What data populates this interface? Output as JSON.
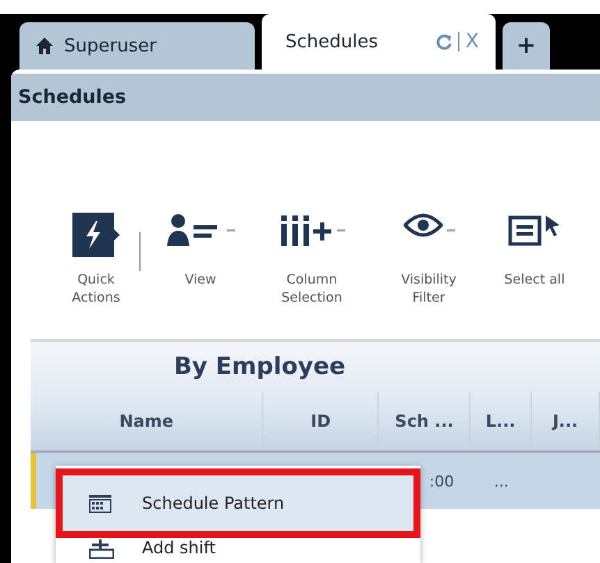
{
  "tabs": [
    {
      "label": "Superuser",
      "kind": "home",
      "selected": false
    },
    {
      "label": "Schedules",
      "kind": "page",
      "selected": true,
      "refresh": true,
      "close": "X"
    },
    {
      "label": "+",
      "kind": "add",
      "selected": false
    }
  ],
  "panel": {
    "title": "Schedules"
  },
  "toolbar": [
    {
      "label": "Quick Actions",
      "kind": "quick",
      "dropdown": false
    },
    {
      "label": "View",
      "kind": "view",
      "dropdown": true
    },
    {
      "label": "Column Selection",
      "kind": "columns",
      "dropdown": true
    },
    {
      "label": "Visibility Filter",
      "kind": "visibility",
      "dropdown": true
    },
    {
      "label": "Select all",
      "kind": "select",
      "dropdown": false
    }
  ],
  "table": {
    "title": "By Employee",
    "columns": [
      "Name",
      "ID",
      "Sch ...",
      "L...",
      "J..."
    ],
    "rows": [
      {
        "selected": true,
        "flagged": true,
        "cells": [
          null,
          null,
          ":00",
          "...",
          null
        ]
      }
    ]
  },
  "context_menu": {
    "items": [
      {
        "label": "Schedule Pattern",
        "kind": "pattern",
        "selected": true
      },
      {
        "label": "Add shift",
        "kind": "add",
        "selected": false
      }
    ]
  }
}
